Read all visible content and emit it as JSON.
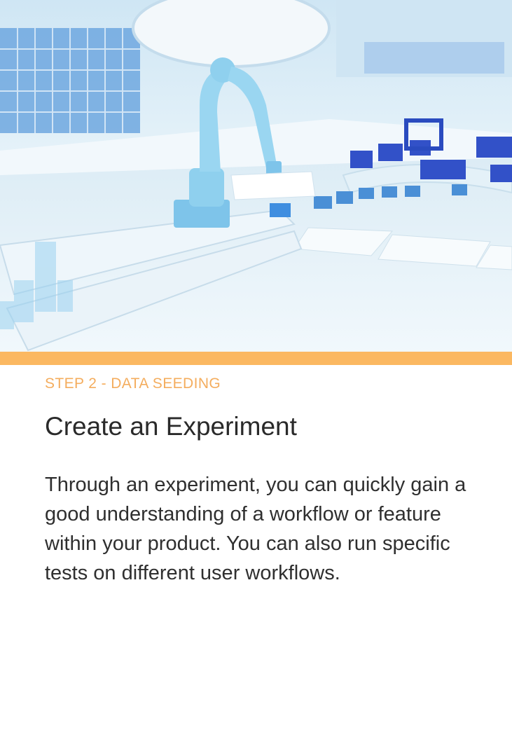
{
  "hero": {
    "image_name": "robotic-factory-illustration",
    "colors": {
      "sky": "#e6f3fb",
      "machine": "#8fd0ee",
      "box": "#2f4fc4",
      "floor": "#eaf6fb"
    }
  },
  "accent_bar": {
    "color": "#fbb861"
  },
  "card": {
    "step_label": "STEP 2 - DATA SEEDING",
    "title": "Create an Experiment",
    "body": "Through an experiment, you can quickly gain a good understanding of a workflow or feature within your product. You can also run specific tests on different user workflows."
  }
}
